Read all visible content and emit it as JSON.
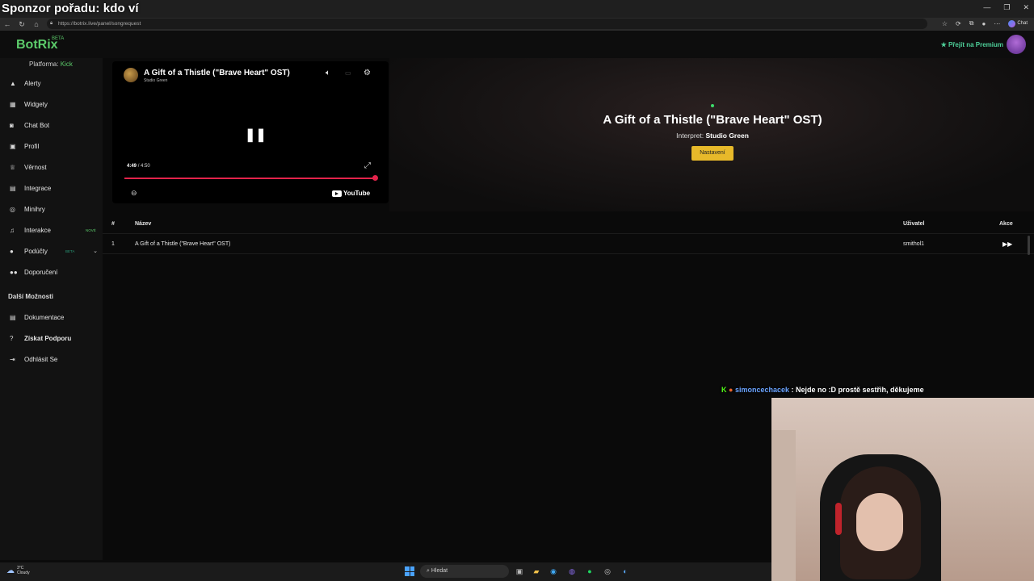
{
  "overlay": {
    "sponsor_title": "Sponzor pořadu: kdo ví",
    "chat": {
      "username": "simoncechacek",
      "message": ": Nejde no :D prostě sestřih, děkujeme"
    }
  },
  "browser": {
    "url": "https://botrix.live/panel/songrequest",
    "chat_button": "Chat"
  },
  "app": {
    "logo": "BotRix",
    "logo_badge": "BETA",
    "premium_label": "Přejít na Premium",
    "platform_label": "Platforma:",
    "platform_value": "Kick"
  },
  "sidebar": {
    "items": [
      {
        "label": "Alerty",
        "icon": "warning-icon"
      },
      {
        "label": "Widgety",
        "icon": "widgets-icon"
      },
      {
        "label": "Chat Bot",
        "icon": "chat-icon"
      },
      {
        "label": "Profil",
        "icon": "profile-icon"
      },
      {
        "label": "Věrnost",
        "icon": "trophy-icon"
      },
      {
        "label": "Integrace",
        "icon": "integration-icon"
      },
      {
        "label": "Minihry",
        "icon": "gamepad-icon"
      },
      {
        "label": "Interakce",
        "icon": "music-icon",
        "badge": "NOVÉ"
      },
      {
        "label": "Podúčty",
        "icon": "user-icon",
        "badge": "BETA"
      },
      {
        "label": "Doporučení",
        "icon": "users-icon"
      }
    ],
    "section_title": "Další Možnosti",
    "more_items": [
      {
        "label": "Dokumentace",
        "icon": "document-icon"
      },
      {
        "label": "Získat Podporu",
        "icon": "help-icon"
      },
      {
        "label": "Odhlásit Se",
        "icon": "logout-icon"
      }
    ]
  },
  "player": {
    "title": "A Gift of a Thistle (\"Brave Heart\" OST)",
    "artist": "Studio Green",
    "current_time": "4:49",
    "duration": "/ 4:50",
    "progress": 0.997,
    "provider": "YouTube"
  },
  "now_playing": {
    "title": "A Gift of a Thistle (\"Brave Heart\" OST)",
    "artist_label": "Interpret:",
    "artist": "Studio Green",
    "settings_button": "Nastavení"
  },
  "queue": {
    "columns": [
      "#",
      "Název",
      "Uživatel",
      "Akce"
    ],
    "rows": [
      {
        "index": "1",
        "title": "A Gift of a Thistle (\"Brave Heart\" OST)",
        "user": "smithol1"
      }
    ]
  },
  "taskbar": {
    "temperature": "3°C",
    "weather": "Cloudy",
    "search_placeholder": "Hledat"
  }
}
